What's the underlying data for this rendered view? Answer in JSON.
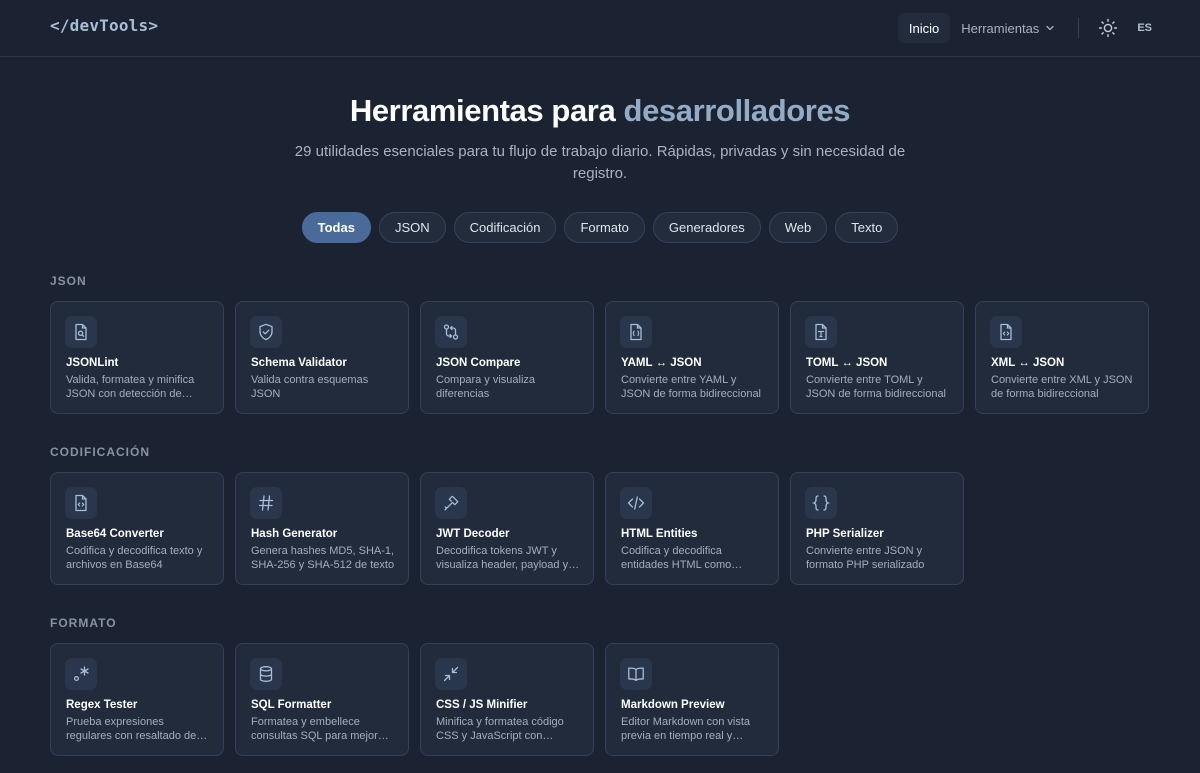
{
  "header": {
    "logo": "</devTools>",
    "nav": {
      "home": "Inicio",
      "tools": "Herramientas"
    },
    "lang": "ES"
  },
  "hero": {
    "title_main": "Herramientas para ",
    "title_accent": "desarrolladores",
    "subtitle": "29 utilidades esenciales para tu flujo de trabajo diario. Rápidas, privadas y sin necesidad de registro."
  },
  "filters": [
    "Todas",
    "JSON",
    "Codificación",
    "Formato",
    "Generadores",
    "Web",
    "Texto"
  ],
  "active_filter": "Todas",
  "sections": [
    {
      "label": "JSON",
      "tools": [
        {
          "name": "JSONLint",
          "desc": "Valida, formatea y minifica JSON con detección de errores",
          "icon": "file-search-icon"
        },
        {
          "name": "Schema Validator",
          "desc": "Valida contra esquemas JSON",
          "icon": "shield-check-icon"
        },
        {
          "name": "JSON Compare",
          "desc": "Compara y visualiza diferencias",
          "icon": "git-compare-icon"
        },
        {
          "name": "YAML ↔ JSON",
          "desc": "Convierte entre YAML y JSON de forma bidireccional",
          "icon": "file-json-icon"
        },
        {
          "name": "TOML ↔ JSON",
          "desc": "Convierte entre TOML y JSON de forma bidireccional",
          "icon": "file-type-icon"
        },
        {
          "name": "XML ↔ JSON",
          "desc": "Convierte entre XML y JSON de forma bidireccional",
          "icon": "file-code-icon"
        }
      ]
    },
    {
      "label": "CODIFICACIÓN",
      "tools": [
        {
          "name": "Base64 Converter",
          "desc": "Codifica y decodifica texto y archivos en Base64",
          "icon": "file-code-icon"
        },
        {
          "name": "Hash Generator",
          "desc": "Genera hashes MD5, SHA-1, SHA-256 y SHA-512 de texto",
          "icon": "hash-icon"
        },
        {
          "name": "JWT Decoder",
          "desc": "Decodifica tokens JWT y visualiza header, payload y firma",
          "icon": "key-icon"
        },
        {
          "name": "HTML Entities",
          "desc": "Codifica y decodifica entidades HTML como &amp; y &lt;",
          "icon": "code-icon"
        },
        {
          "name": "PHP Serializer",
          "desc": "Convierte entre JSON y formato PHP serializado",
          "icon": "braces-icon"
        }
      ]
    },
    {
      "label": "FORMATO",
      "tools": [
        {
          "name": "Regex Tester",
          "desc": "Prueba expresiones regulares con resaltado de coincidencias",
          "icon": "regex-icon"
        },
        {
          "name": "SQL Formatter",
          "desc": "Formatea y embellece consultas SQL para mejor legibilidad",
          "icon": "database-icon"
        },
        {
          "name": "CSS / JS Minifier",
          "desc": "Minifica y formatea código CSS y JavaScript con facilidad",
          "icon": "minimize-icon"
        },
        {
          "name": "Markdown Preview",
          "desc": "Editor Markdown con vista previa en tiempo real y exportación",
          "icon": "book-open-icon"
        }
      ]
    }
  ]
}
